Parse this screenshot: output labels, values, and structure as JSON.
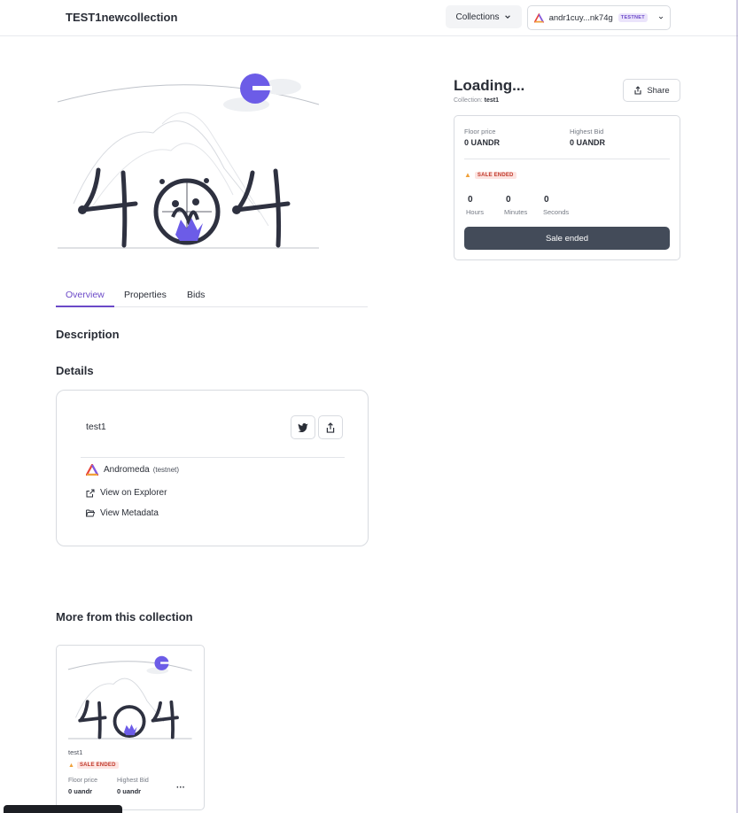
{
  "header": {
    "brand": "TEST1newcollection",
    "collections_label": "Collections",
    "wallet_address": "andr1cuy...nk74g",
    "network_badge": "TESTNET"
  },
  "hero": {
    "image_text": "404",
    "accent_color": "#6c5ce7"
  },
  "item": {
    "title": "Loading...",
    "collection_prefix": "Collection:",
    "collection_name": "test1",
    "share_label": "Share"
  },
  "sale": {
    "floor_label": "Floor price",
    "floor_value": "0 UANDR",
    "bid_label": "Highest Bid",
    "bid_value": "0 UANDR",
    "status_badge": "SALE ENDED",
    "hours_value": "0",
    "hours_label": "Hours",
    "minutes_value": "0",
    "minutes_label": "Minutes",
    "seconds_value": "0",
    "seconds_label": "Seconds",
    "button_label": "Sale ended"
  },
  "tabs": {
    "overview": "Overview",
    "properties": "Properties",
    "bids": "Bids"
  },
  "sections": {
    "description": "Description",
    "details": "Details",
    "more": "More from this collection"
  },
  "details": {
    "name": "test1",
    "chain_name": "Andromeda",
    "chain_network": "(testnet)",
    "explorer_link": "View on Explorer",
    "metadata_link": "View Metadata"
  },
  "more_card": {
    "name": "test1",
    "status_badge": "SALE ENDED",
    "floor_label": "Floor price",
    "floor_value": "0 uandr",
    "bid_label": "Highest Bid",
    "bid_value": "0 uandr",
    "menu_label": "···"
  }
}
